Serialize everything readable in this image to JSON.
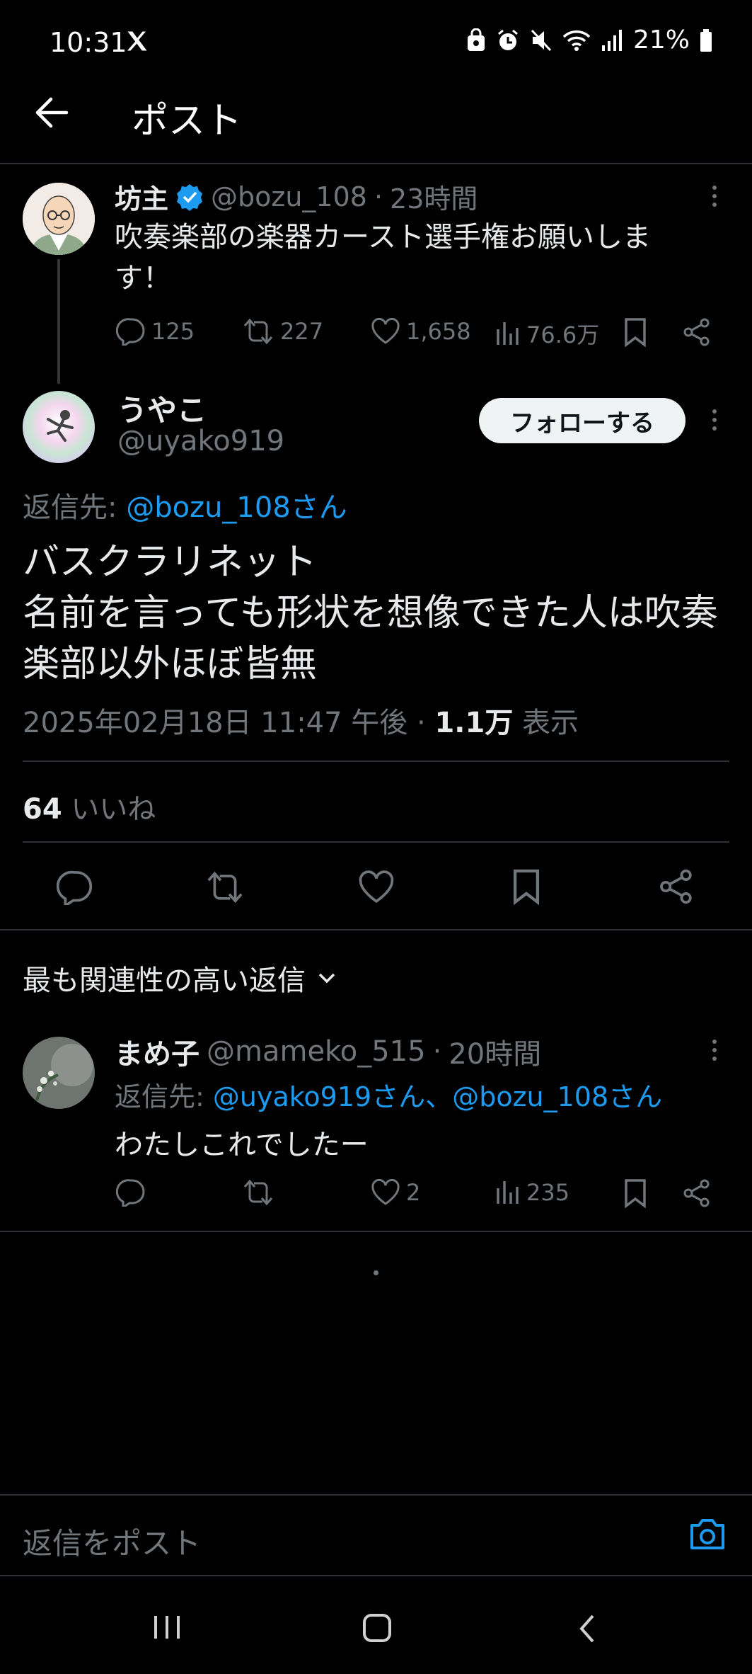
{
  "status_bar": {
    "time": "10:31",
    "battery": "21%"
  },
  "header": {
    "title": "ポスト"
  },
  "parent_post": {
    "name": "坊主",
    "handle": "@bozu_108",
    "time": "23時間",
    "text_line1": "吹奏楽部の楽器カースト選手権お願いしま",
    "text_line2": "す！",
    "replies": "125",
    "reposts": "227",
    "likes": "1,658",
    "views": "76.6万"
  },
  "main_post": {
    "name": "うやこ",
    "handle": "@uyako919",
    "follow_label": "フォローする",
    "reply_to_label": "返信先:",
    "reply_to_user": "@bozu_108さん",
    "text_line1": "バスクラリネット",
    "text_line2": "名前を言っても形状を想像できた人は吹奏",
    "text_line3": "楽部以外ほぼ皆無",
    "timestamp": "2025年02月18日 11:47 午後",
    "views_count": "1.1万",
    "views_label": "表示",
    "likes_count": "64",
    "likes_label": "いいね"
  },
  "replies_section": {
    "sort_label": "最も関連性の高い返信"
  },
  "reply_post": {
    "name": "まめ子",
    "handle": "@mameko_515",
    "time": "20時間",
    "reply_to_label": "返信先:",
    "reply_to_users": "@uyako919さん、@bozu_108さん",
    "text": "わたしこれでしたー",
    "likes": "2",
    "views": "235"
  },
  "composer": {
    "placeholder": "返信をポスト"
  },
  "colors": {
    "accent": "#1d9bf0",
    "background": "#000000",
    "muted": "#71767b",
    "divider": "#2f3336"
  }
}
